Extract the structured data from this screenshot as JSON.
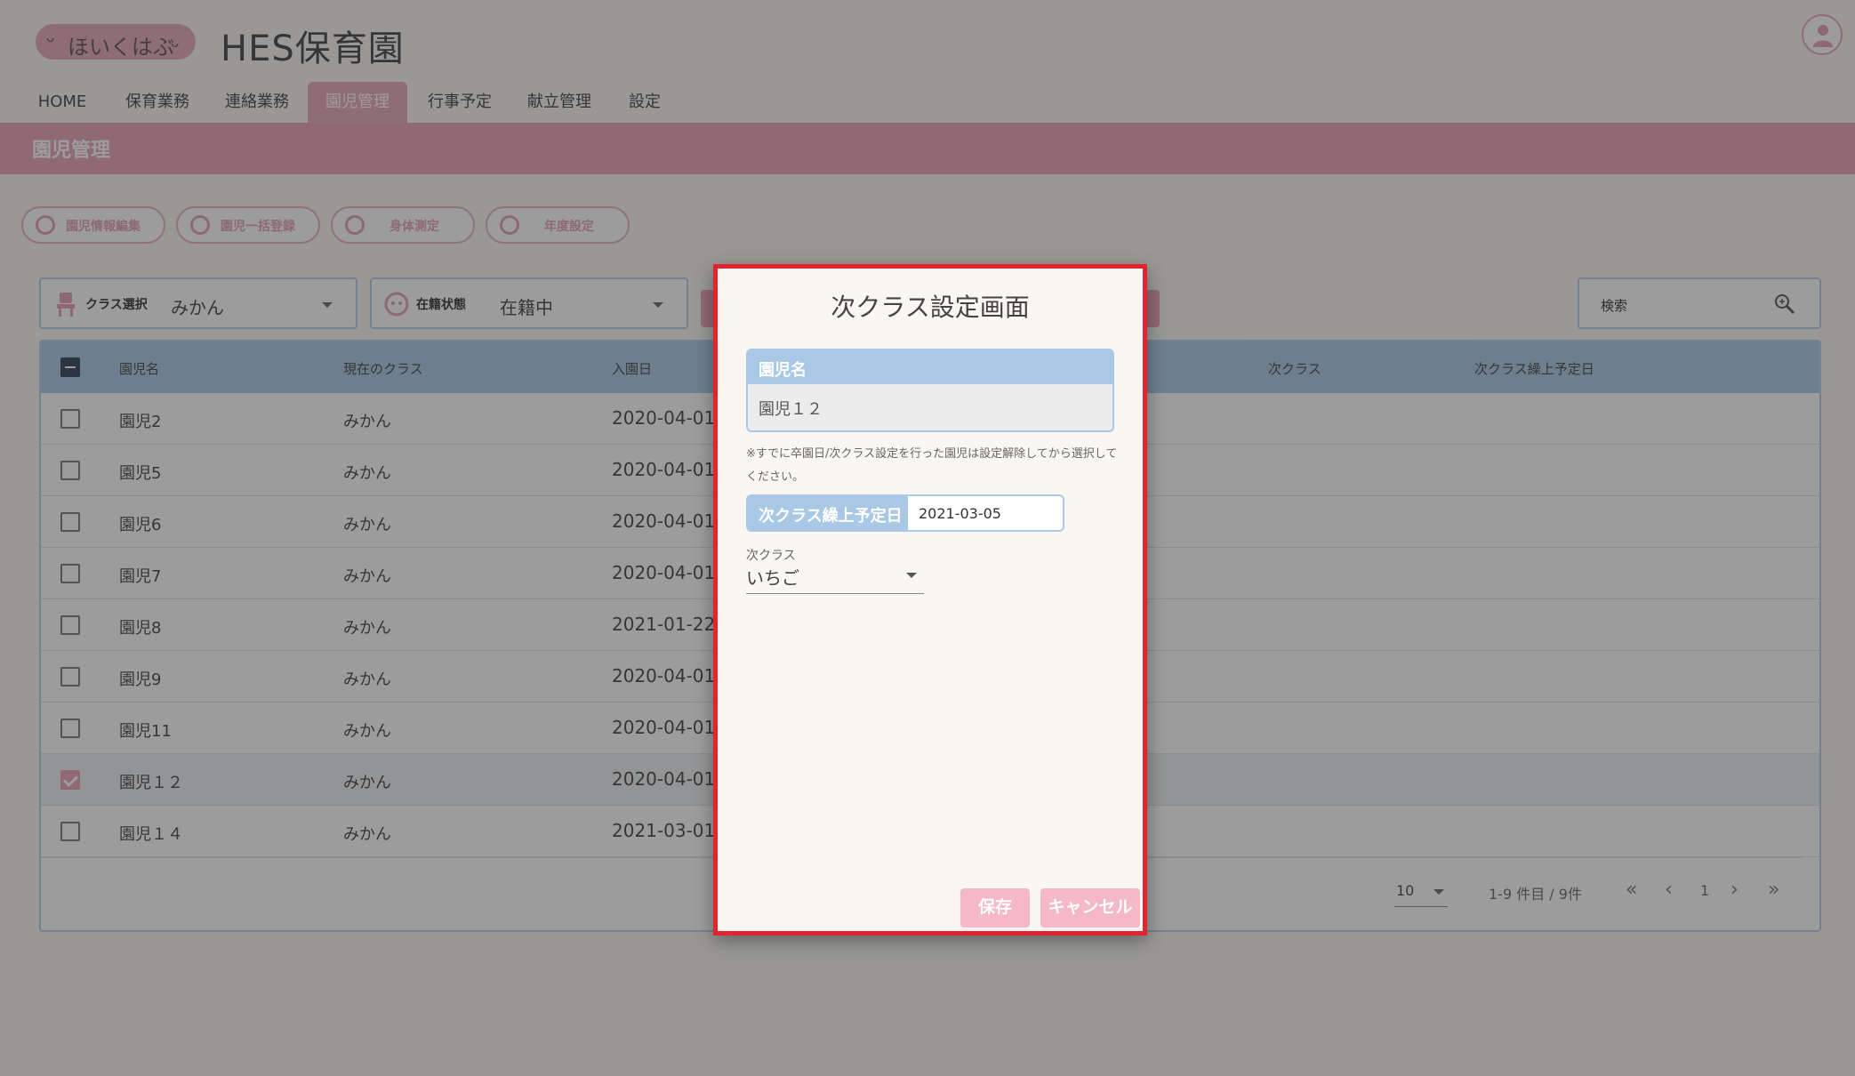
{
  "header": {
    "logo_text": "ほいくはぶ",
    "site_title": "HES保育園"
  },
  "nav": {
    "items": [
      "HOME",
      "保育業務",
      "連絡業務",
      "園児管理",
      "行事予定",
      "献立管理",
      "設定"
    ],
    "active": "園児管理"
  },
  "page_title": "園児管理",
  "actions": [
    "園児情報編集",
    "園児一括登録",
    "身体測定",
    "年度設定"
  ],
  "filters": {
    "class_label": "クラス選択",
    "class_value": "みかん",
    "status_label": "在籍状態",
    "status_value": "在籍中"
  },
  "search": {
    "placeholder": "検索"
  },
  "table": {
    "headers": [
      "園児名",
      "現在のクラス",
      "入園日",
      "次クラス",
      "次クラス繰上予定日"
    ],
    "rows": [
      {
        "name": "園児2",
        "class": "みかん",
        "date": "2020-04-01",
        "checked": false
      },
      {
        "name": "園児5",
        "class": "みかん",
        "date": "2020-04-01",
        "checked": false
      },
      {
        "name": "園児6",
        "class": "みかん",
        "date": "2020-04-01",
        "checked": false
      },
      {
        "name": "園児7",
        "class": "みかん",
        "date": "2020-04-01",
        "checked": false
      },
      {
        "name": "園児8",
        "class": "みかん",
        "date": "2021-01-22",
        "checked": false
      },
      {
        "name": "園児9",
        "class": "みかん",
        "date": "2020-04-01",
        "checked": false
      },
      {
        "name": "園児11",
        "class": "みかん",
        "date": "2020-04-01",
        "checked": false
      },
      {
        "name": "園児１２",
        "class": "みかん",
        "date": "2020-04-01",
        "checked": true
      },
      {
        "name": "園児１４",
        "class": "みかん",
        "date": "2021-03-01",
        "checked": false
      }
    ]
  },
  "pagination": {
    "per_page": "10",
    "range": "1-9 件目 / 9件",
    "page": "1"
  },
  "dialog": {
    "title": "次クラス設定画面",
    "name_label": "園児名",
    "name_value": "園児１２",
    "note": "※すでに卒園日/次クラス設定を行った園児は設定解除してから選択してください。",
    "date_label": "次クラス繰上予定日",
    "date_value": "2021-03-05",
    "next_class_label": "次クラス",
    "next_class_value": "いちご",
    "save_label": "保存",
    "cancel_label": "キャンセル"
  },
  "colors": {
    "accent_pink": "#e9a2b5",
    "accent_blue": "#a9c8e6",
    "highlight_border": "#e1242e"
  }
}
